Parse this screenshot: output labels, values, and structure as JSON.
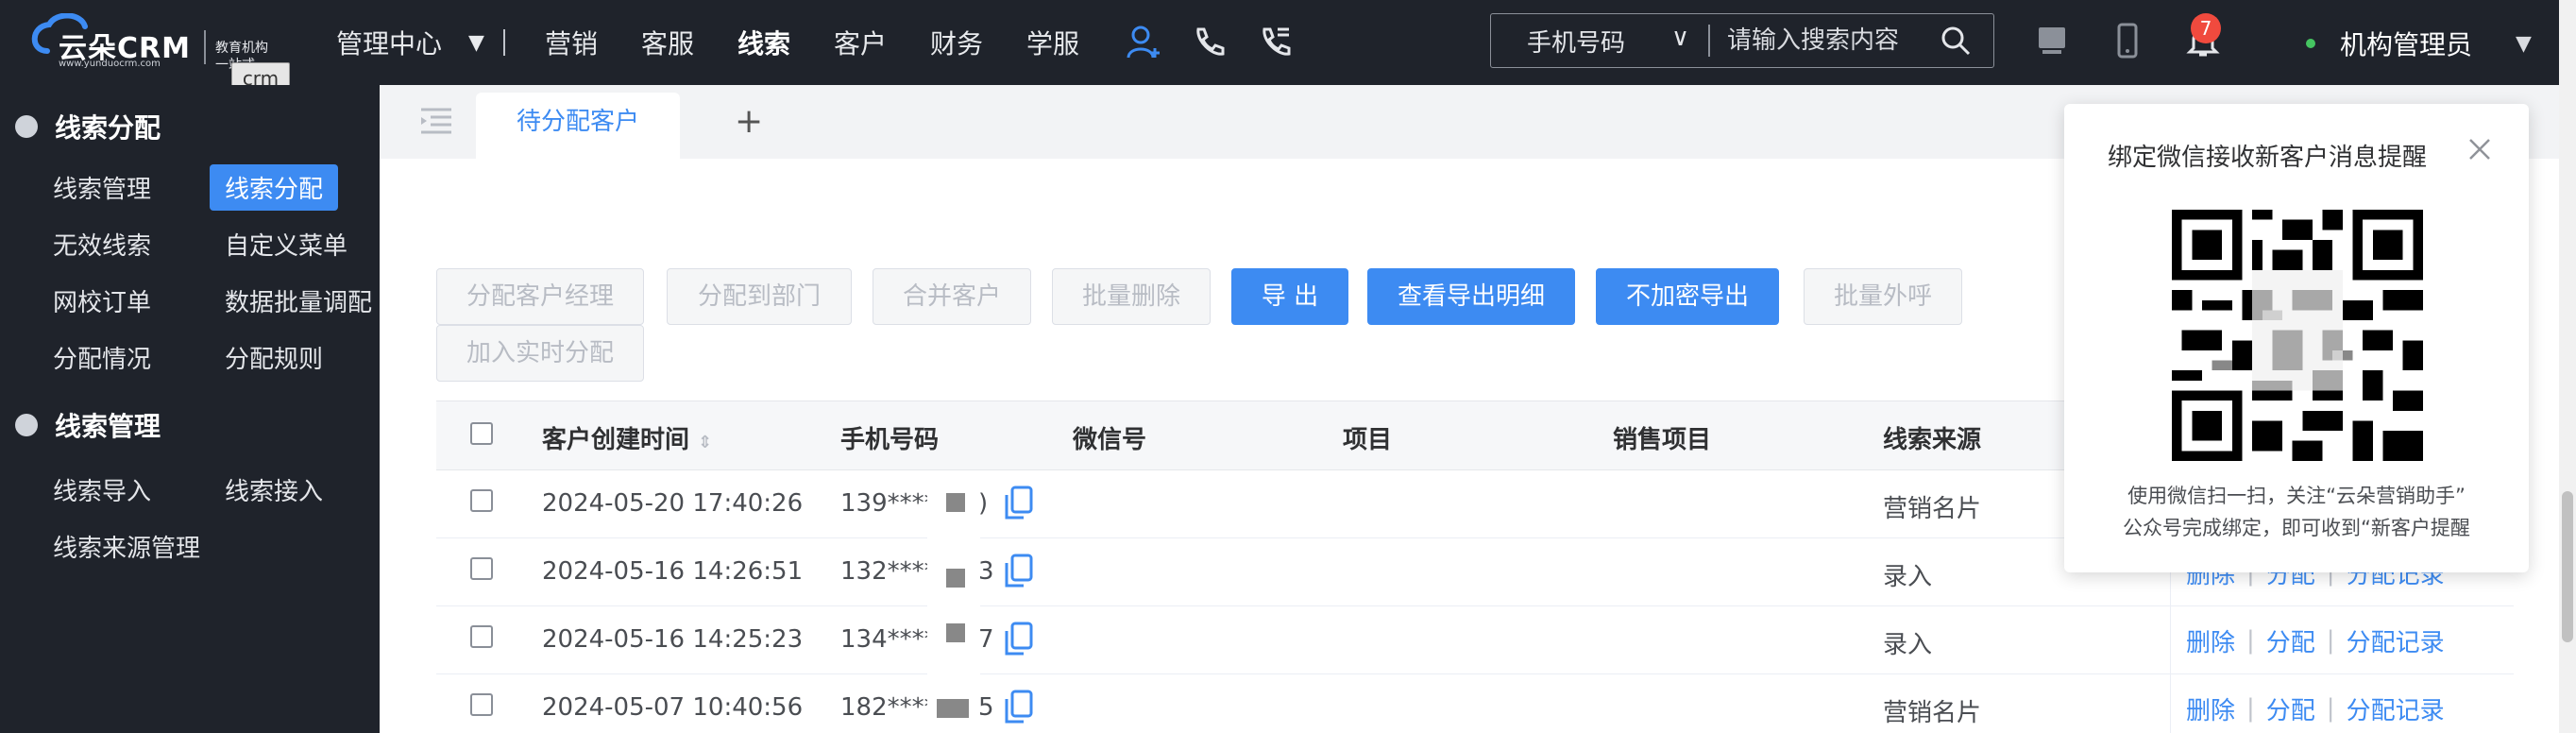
{
  "header": {
    "logo_text": "云朵CRM",
    "logo_url_text": "www.yunduocrm.com",
    "logo_slogan": "教育机构一站式",
    "logo_tooltip": "crm",
    "nav": {
      "admin_center": "管理中心",
      "marketing": "营销",
      "service": "客服",
      "leads": "线索",
      "customers": "客户",
      "finance": "财务",
      "academic": "学服"
    },
    "search": {
      "type_label": "手机号码",
      "placeholder": "请输入搜索内容"
    },
    "notification_count": "7",
    "user_name": "机构管理员"
  },
  "sidebar": {
    "group1": {
      "label": "线索分配",
      "items": [
        "线索管理",
        "线索分配",
        "无效线索",
        "自定义菜单",
        "网校订单",
        "数据批量调配",
        "分配情况",
        "分配规则"
      ]
    },
    "group2": {
      "label": "线索管理",
      "items": [
        "线索导入",
        "线索接入",
        "线索来源管理"
      ]
    }
  },
  "tabs": {
    "active": "待分配客户",
    "add": "+"
  },
  "toolbar": {
    "assign_manager": "分配客户经理",
    "assign_dept": "分配到部门",
    "merge": "合并客户",
    "batch_delete": "批量删除",
    "export": "导 出",
    "export_detail": "查看导出明细",
    "export_plain": "不加密导出",
    "batch_call": "批量外呼",
    "add_realtime": "加入实时分配"
  },
  "table": {
    "headers": {
      "created": "客户创建时间",
      "phone": "手机号码",
      "wechat": "微信号",
      "project": "项目",
      "sales_project": "销售项目",
      "source": "线索来源"
    },
    "rows": [
      {
        "created": "2024-05-20 17:40:26",
        "phone": "139****",
        "phone_end": ")",
        "source": "营销名片"
      },
      {
        "created": "2024-05-16 14:26:51",
        "phone": "132****",
        "phone_end": "3",
        "source": "录入"
      },
      {
        "created": "2024-05-16 14:25:23",
        "phone": "134****",
        "phone_end": "7",
        "source": "录入"
      },
      {
        "created": "2024-05-07 10:40:56",
        "phone": "182****",
        "phone_end": "5",
        "source": "营销名片"
      }
    ],
    "ops": {
      "delete": "删除",
      "assign": "分配",
      "record": "分配记录"
    }
  },
  "popup": {
    "title": "绑定微信接收新客户消息提醒",
    "desc_line1": "使用微信扫一扫，关注“云朵营销助手”",
    "desc_line2": "公众号完成绑定，即可收到“新客户提醒"
  },
  "colors": {
    "primary": "#3d8bf2",
    "dark_bg": "#1f232b",
    "badge": "#f04a3e"
  }
}
